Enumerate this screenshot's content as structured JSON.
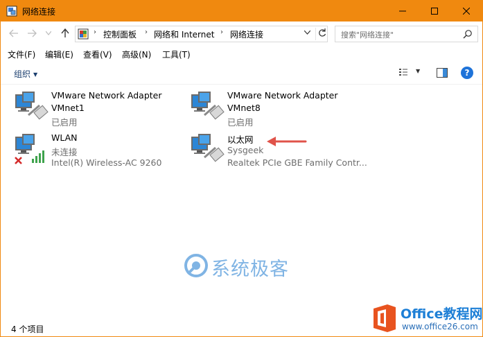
{
  "window": {
    "title": "网络连接",
    "accent_color": "#f0890f"
  },
  "address": {
    "crumbs": [
      "控制面板",
      "网络和 Internet",
      "网络连接"
    ]
  },
  "search": {
    "placeholder": "搜索\"网络连接\""
  },
  "menu": {
    "items": [
      "文件(F)",
      "编辑(E)",
      "查看(V)",
      "高级(N)",
      "工具(T)"
    ]
  },
  "toolbar": {
    "organize_label": "组织",
    "help_label": "?"
  },
  "adapters": [
    {
      "name": "VMware Network Adapter",
      "line2": "VMnet1",
      "line3": "已启用",
      "icon": "network-adapter-icon"
    },
    {
      "name": "VMware Network Adapter",
      "line2": "VMnet8",
      "line3": "已启用",
      "icon": "network-adapter-icon"
    },
    {
      "name": "WLAN",
      "line2": "未连接",
      "line3": "Intel(R) Wireless-AC 9260",
      "icon": "wireless-adapter-icon"
    },
    {
      "name": "以太网",
      "line2": "Sysgeek",
      "line3": "Realtek PCIe GBE Family Contr...",
      "icon": "ethernet-adapter-icon"
    }
  ],
  "watermark": {
    "text": "系统极客"
  },
  "status": {
    "item_count": "4 个项目"
  },
  "brand": {
    "name": "Office教程网",
    "url": "www.office26.com"
  }
}
